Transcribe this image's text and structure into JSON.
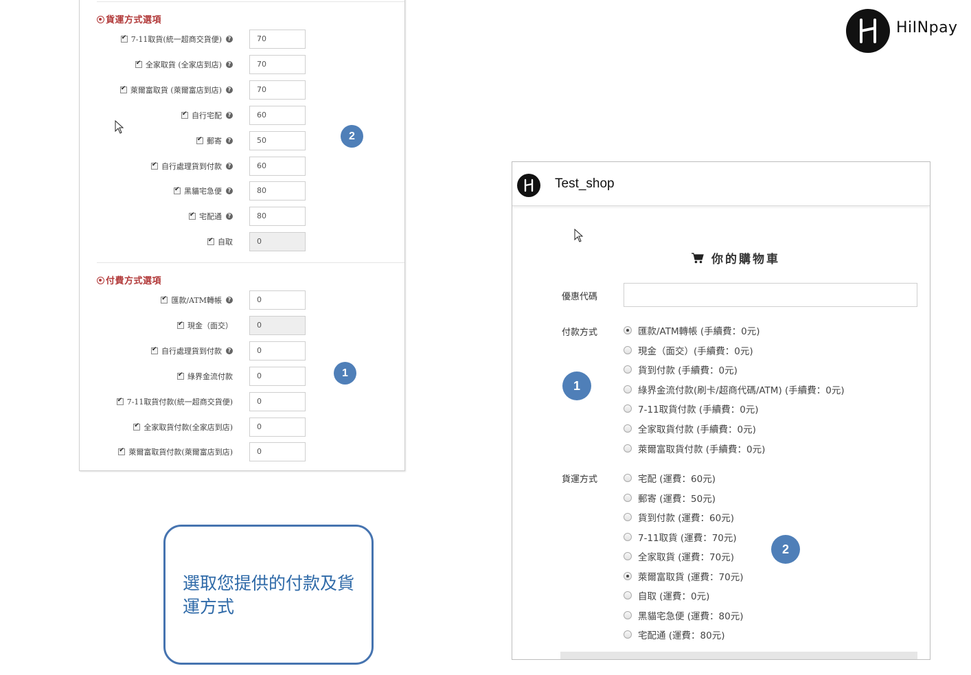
{
  "admin": {
    "shipping_title": "貨運方式選項",
    "shipping_options": [
      {
        "label": "7-11取貨(統一超商交貨便)",
        "value": "70",
        "help": true,
        "disabled": false
      },
      {
        "label": "全家取貨 (全家店到店)",
        "value": "70",
        "help": true,
        "disabled": false
      },
      {
        "label": "萊爾富取貨 (萊爾富店到店)",
        "value": "70",
        "help": true,
        "disabled": false
      },
      {
        "label": "自行宅配",
        "value": "60",
        "help": true,
        "disabled": false
      },
      {
        "label": "郵寄",
        "value": "50",
        "help": true,
        "disabled": false
      },
      {
        "label": "自行處理貨到付款",
        "value": "60",
        "help": true,
        "disabled": false
      },
      {
        "label": "黑貓宅急便",
        "value": "80",
        "help": true,
        "disabled": false
      },
      {
        "label": "宅配通",
        "value": "80",
        "help": true,
        "disabled": false
      },
      {
        "label": "自取",
        "value": "0",
        "help": false,
        "disabled": true
      }
    ],
    "payment_title": "付費方式選項",
    "payment_options": [
      {
        "label": "匯款/ATM轉帳",
        "value": "0",
        "help": true,
        "disabled": false
      },
      {
        "label": "現金（面交）",
        "value": "0",
        "help": false,
        "disabled": true
      },
      {
        "label": "自行處理貨到付款",
        "value": "0",
        "help": true,
        "disabled": false
      },
      {
        "label": "綠界金流付款",
        "value": "0",
        "help": false,
        "disabled": false
      },
      {
        "label": "7-11取貨付款(統一超商交貨便)",
        "value": "0",
        "help": false,
        "disabled": false
      },
      {
        "label": "全家取貨付款(全家店到店)",
        "value": "0",
        "help": false,
        "disabled": false
      },
      {
        "label": "萊爾富取貨付款(萊爾富店到店)",
        "value": "0",
        "help": false,
        "disabled": false
      }
    ]
  },
  "badges": {
    "one": "1",
    "two": "2"
  },
  "callout": {
    "text": "選取您提供的付款及貨運方式"
  },
  "brand": {
    "name": "HiINpay"
  },
  "shop": {
    "name": "Test_shop",
    "cart_title": "你的購物車",
    "coupon_label": "優惠代碼",
    "payment_label": "付款方式",
    "payment_methods": [
      {
        "label": "匯款/ATM轉帳 (手續費：0元)",
        "selected": true
      },
      {
        "label": "現金（面交）(手續費：0元)",
        "selected": false
      },
      {
        "label": "貨到付款 (手續費：0元)",
        "selected": false
      },
      {
        "label": "綠界金流付款(刷卡/超商代碼/ATM) (手續費：0元)",
        "selected": false
      },
      {
        "label": "7-11取貨付款 (手續費：0元)",
        "selected": false
      },
      {
        "label": "全家取貨付款 (手續費：0元)",
        "selected": false
      },
      {
        "label": "萊爾富取貨付款 (手續費：0元)",
        "selected": false
      }
    ],
    "shipping_label": "貨運方式",
    "shipping_methods": [
      {
        "label": "宅配 (運費：60元)",
        "selected": false
      },
      {
        "label": "郵寄 (運費：50元)",
        "selected": false
      },
      {
        "label": "貨到付款 (運費：60元)",
        "selected": false
      },
      {
        "label": "7-11取貨 (運費：70元)",
        "selected": false
      },
      {
        "label": "全家取貨 (運費：70元)",
        "selected": false
      },
      {
        "label": "萊爾富取貨 (運費：70元)",
        "selected": true
      },
      {
        "label": "自取 (運費：0元)",
        "selected": false
      },
      {
        "label": "黑貓宅急便 (運費：80元)",
        "selected": false
      },
      {
        "label": "宅配通 (運費：80元)",
        "selected": false
      }
    ]
  },
  "colors": {
    "accent": "#4f7fb8",
    "section_title": "#b23a3a",
    "callout": "#2f6aa8"
  }
}
